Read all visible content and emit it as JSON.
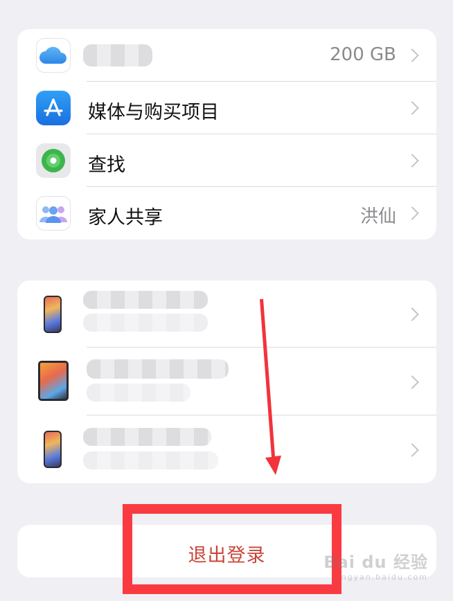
{
  "account_group": {
    "items": [
      {
        "name": "icloud",
        "label": "",
        "value": "200 GB",
        "icon": "icloud-icon",
        "label_redacted": true
      },
      {
        "name": "media-purchases",
        "label": "媒体与购买项目",
        "value": "",
        "icon": "app-store-icon"
      },
      {
        "name": "find-my",
        "label": "查找",
        "value": "",
        "icon": "find-my-icon"
      },
      {
        "name": "family-sharing",
        "label": "家人共享",
        "value": "洪仙",
        "icon": "family-sharing-icon"
      }
    ]
  },
  "devices_group": {
    "items": [
      {
        "name": "device-iphone-1",
        "icon": "iphone-icon",
        "redacted": true
      },
      {
        "name": "device-ipad",
        "icon": "ipad-icon",
        "redacted": true
      },
      {
        "name": "device-iphone-2",
        "icon": "iphone-icon",
        "redacted": true
      }
    ]
  },
  "signout": {
    "label": "退出登录"
  },
  "annotation": {
    "highlight_color": "#fa3a41",
    "arrow_color": "#f2333b"
  },
  "colors": {
    "background": "#efeff4",
    "card": "#ffffff",
    "signout_text": "#c94437",
    "secondary_text": "#8a8a8e"
  },
  "watermark": {
    "text": "Bai du 经验",
    "sub": "jingyan.baidu.com"
  }
}
